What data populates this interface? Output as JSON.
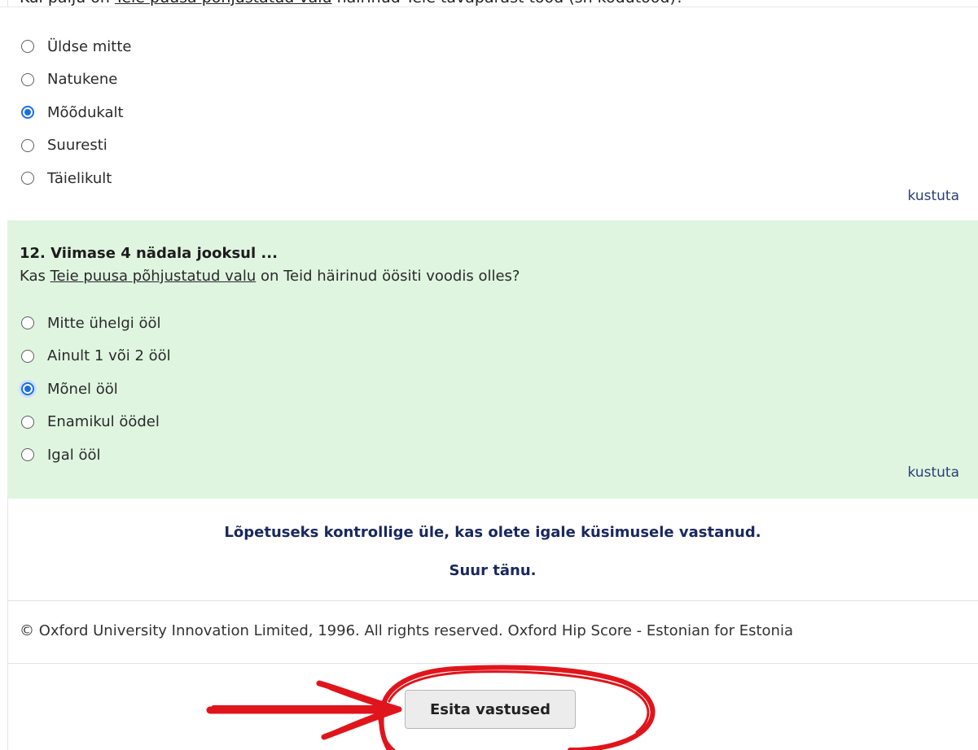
{
  "previous_question": {
    "text_prefix": "Kui palju on ",
    "text_underlined": "Teie puusa põhjustatud valu",
    "text_suffix": " häirinud Teie tavapärast tööd (sh kodutööd)?",
    "options": [
      {
        "label": "Üldse mitte",
        "checked": false
      },
      {
        "label": "Natukene",
        "checked": false
      },
      {
        "label": "Mõõdukalt",
        "checked": true
      },
      {
        "label": "Suuresti",
        "checked": false
      },
      {
        "label": "Täielikult",
        "checked": false
      }
    ],
    "clear_label": "kustuta"
  },
  "question_12": {
    "title": "12. Viimase 4 nädala jooksul ...",
    "text_prefix": "Kas ",
    "text_underlined": "Teie puusa põhjustatud valu",
    "text_suffix": " on Teid häirinud öösiti voodis olles?",
    "options": [
      {
        "label": "Mitte ühelgi ööl",
        "checked": false
      },
      {
        "label": "Ainult 1 või 2 ööl",
        "checked": false
      },
      {
        "label": "Mõnel ööl",
        "checked": true
      },
      {
        "label": "Enamikul öödel",
        "checked": false
      },
      {
        "label": "Igal ööl",
        "checked": false
      }
    ],
    "clear_label": "kustuta",
    "background_color": "#dff5e0"
  },
  "closing": {
    "line1": "Lõpetuseks kontrollige üle, kas olete igale küsimusele vastanud.",
    "line2": "Suur tänu."
  },
  "footer": {
    "copyright": "© Oxford University Innovation Limited, 1996. All rights reserved. Oxford Hip Score - Estonian for Estonia"
  },
  "submit": {
    "label": "Esita vastused"
  },
  "colors": {
    "accent": "#1a6fe0",
    "link": "#2c3f75",
    "closing_text": "#1a2860",
    "annotation": "#e0151b"
  }
}
